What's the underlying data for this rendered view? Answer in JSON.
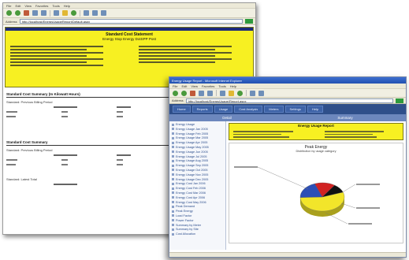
{
  "back_window": {
    "menu": [
      "File",
      "Edit",
      "View",
      "Favorites",
      "Tools",
      "Help"
    ],
    "address_label": "Address",
    "address": "http://localhost/EnergyUsageReport/Default.aspx",
    "report_title": "Standard Cost Statement",
    "report_subtitle": "Energy Stop Energy DotSPP Post",
    "section1_title": "Standard Cost Summary (In Kilowatt Hours)",
    "section1_sub": "Standard: Previous Billing Period",
    "section2_title": "Standard Cost Summary",
    "section2_sub": "Standard: Previous Billing Period",
    "section3_label": "Standard: Latest Total"
  },
  "front_window": {
    "title": "Energy Usage Report - Microsoft Internet Explorer",
    "menu": [
      "File",
      "Edit",
      "View",
      "Favorites",
      "Tools",
      "Help"
    ],
    "address_label": "Address",
    "address": "http://localhost/EnergyUsage/Report.aspx",
    "nav_tabs": [
      "Home",
      "Reports",
      "Usage",
      "Cost Analysis",
      "Meters",
      "Settings",
      "Help"
    ],
    "sub_left": "Detail",
    "sub_right": "Summary",
    "usage_title": "Energy Usage Report",
    "chart_title": "Peak Energy",
    "chart_subtitle": "Distribution by usage category",
    "left_nav": [
      "Energy Usage",
      "Energy Usage Jan 2005",
      "Energy Usage Feb 2005",
      "Energy Usage Mar 2005",
      "Energy Usage Apr 2005",
      "Energy Usage May 2005",
      "Energy Usage Jun 2005",
      "Energy Usage Jul 2005",
      "Energy Usage Aug 2005",
      "Energy Usage Sep 2005",
      "Energy Usage Oct 2005",
      "Energy Usage Nov 2005",
      "Energy Usage Dec 2005",
      "Energy Cost Jan 2006",
      "Energy Cost Feb 2006",
      "Energy Cost Mar 2006",
      "Energy Cost Apr 2006",
      "Energy Cost May 2006",
      "Peak Demand",
      "Peak Energy",
      "Load Factor",
      "Power Factor",
      "Summary by Meter",
      "Summary by Site",
      "Cost Allocation"
    ]
  },
  "colors": {
    "report_yellow": "#f7f022",
    "nav_blue": "#2f4f8a",
    "slice_yellow": "#f2e52a",
    "slice_blue": "#2d4fb5",
    "slice_red": "#d12222",
    "slice_black": "#111111"
  },
  "chart_data": {
    "type": "pie",
    "title": "Peak Energy",
    "subtitle": "Distribution by usage category",
    "slices": [
      {
        "name": "",
        "value": 55,
        "color": "#f2e52a"
      },
      {
        "name": "",
        "value": 20,
        "color": "#2d4fb5"
      },
      {
        "name": "",
        "value": 15,
        "color": "#d12222"
      },
      {
        "name": "",
        "value": 10,
        "color": "#111111"
      }
    ],
    "legend": "none"
  }
}
